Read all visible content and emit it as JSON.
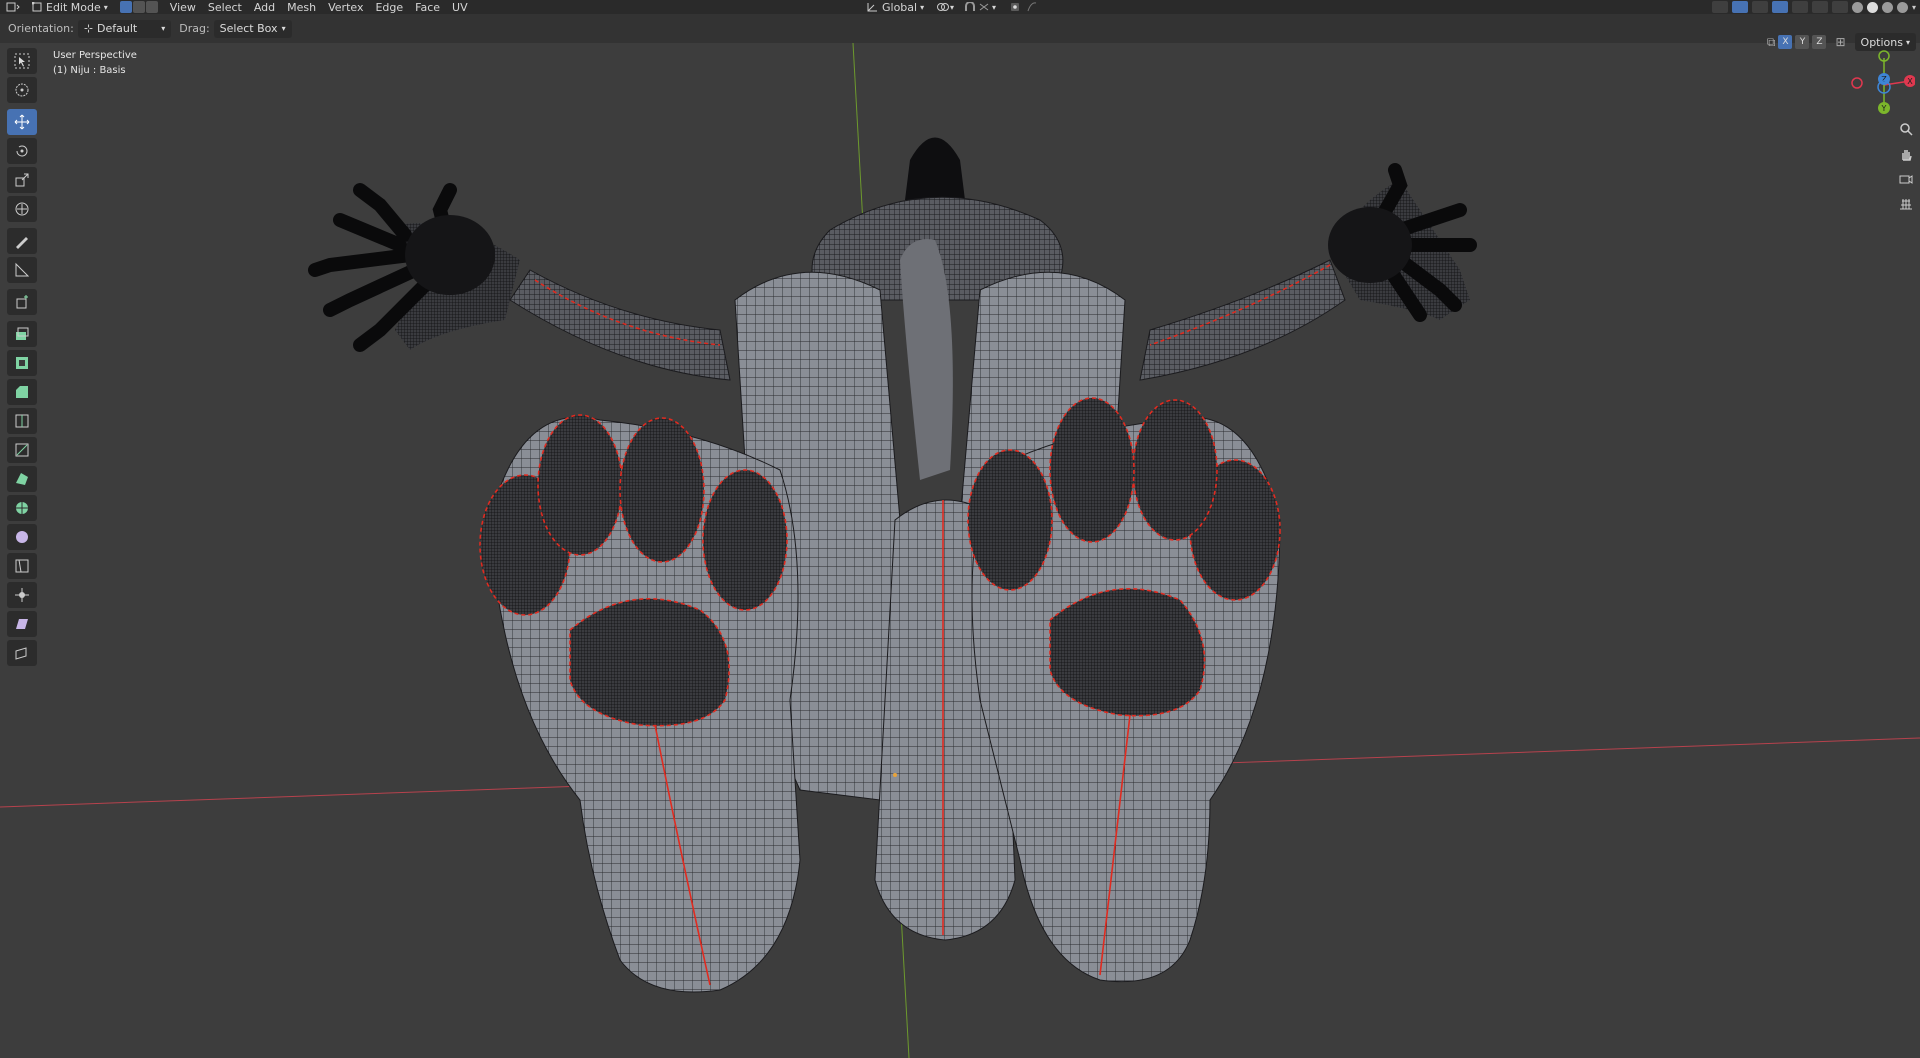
{
  "header": {
    "editor_type_icon": "3d-viewport-icon",
    "mode_label": "Edit Mode",
    "select_modes": [
      "vertex",
      "edge",
      "face"
    ],
    "menus": [
      "View",
      "Select",
      "Add",
      "Mesh",
      "Vertex",
      "Edge",
      "Face",
      "UV"
    ],
    "transform_orientation": "Global",
    "snap_icon": "magnet-icon",
    "proportional_icon": "proportional-edit-icon"
  },
  "tool_settings": {
    "orientation_label": "Orientation:",
    "orientation_value": "Default",
    "drag_label": "Drag:",
    "drag_value": "Select Box",
    "mirror_axes": [
      "X",
      "Y",
      "Z"
    ],
    "options_label": "Options"
  },
  "viewport": {
    "perspective_label": "User Perspective",
    "object_label": "(1) Niju : Basis"
  },
  "toolbar": {
    "tools": [
      "select-box",
      "cursor",
      "move",
      "rotate",
      "scale",
      "transform",
      "annotate",
      "measure",
      "add-cube",
      "extrude",
      "inset",
      "bevel",
      "loop-cut",
      "knife",
      "poly-build",
      "spin",
      "smooth",
      "edge-slide",
      "shrink-fatten",
      "shear",
      "rip"
    ],
    "active_tool": "move"
  },
  "gizmo": {
    "axes": [
      "X",
      "Y",
      "Z"
    ],
    "colors": {
      "x": "#e0384f",
      "y": "#7cb62b",
      "z": "#3e85d6"
    }
  },
  "colors": {
    "accent": "#4772b3",
    "background": "#3d3d3d",
    "seam": "#e02b20",
    "mesh": "#8e929a"
  }
}
